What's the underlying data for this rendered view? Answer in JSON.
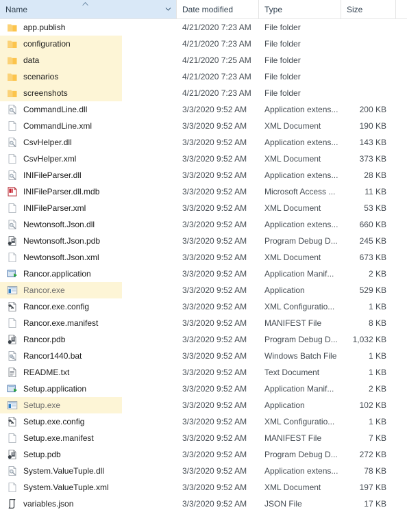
{
  "header": {
    "columns": [
      {
        "label": "Name",
        "sorted": true,
        "sort_direction": "ascending"
      },
      {
        "label": "Date modified",
        "sorted": false
      },
      {
        "label": "Type",
        "sorted": false
      },
      {
        "label": "Size",
        "sorted": false
      }
    ],
    "sort_caret_icon": "sort-ascending-caret-icon",
    "dropdown_icon": "chevron-down-icon"
  },
  "rows": [
    {
      "name": "app.publish",
      "date": "4/21/2020 7:23 AM",
      "type": "File folder",
      "size": "",
      "icon": "folder-icon",
      "highlighted": false,
      "dim": false
    },
    {
      "name": "configuration",
      "date": "4/21/2020 7:23 AM",
      "type": "File folder",
      "size": "",
      "icon": "folder-icon",
      "highlighted": true,
      "dim": false
    },
    {
      "name": "data",
      "date": "4/21/2020 7:25 AM",
      "type": "File folder",
      "size": "",
      "icon": "folder-icon",
      "highlighted": true,
      "dim": false
    },
    {
      "name": "scenarios",
      "date": "4/21/2020 7:23 AM",
      "type": "File folder",
      "size": "",
      "icon": "folder-icon",
      "highlighted": true,
      "dim": false
    },
    {
      "name": "screenshots",
      "date": "4/21/2020 7:23 AM",
      "type": "File folder",
      "size": "",
      "icon": "folder-icon",
      "highlighted": true,
      "dim": false
    },
    {
      "name": "CommandLine.dll",
      "date": "3/3/2020 9:52 AM",
      "type": "Application extens...",
      "size": "200 KB",
      "icon": "dll-icon",
      "highlighted": false,
      "dim": false
    },
    {
      "name": "CommandLine.xml",
      "date": "3/3/2020 9:52 AM",
      "type": "XML Document",
      "size": "190 KB",
      "icon": "blank-document-icon",
      "highlighted": false,
      "dim": false
    },
    {
      "name": "CsvHelper.dll",
      "date": "3/3/2020 9:52 AM",
      "type": "Application extens...",
      "size": "143 KB",
      "icon": "dll-icon",
      "highlighted": false,
      "dim": false
    },
    {
      "name": "CsvHelper.xml",
      "date": "3/3/2020 9:52 AM",
      "type": "XML Document",
      "size": "373 KB",
      "icon": "blank-document-icon",
      "highlighted": false,
      "dim": false
    },
    {
      "name": "INIFileParser.dll",
      "date": "3/3/2020 9:52 AM",
      "type": "Application extens...",
      "size": "28 KB",
      "icon": "dll-icon",
      "highlighted": false,
      "dim": false
    },
    {
      "name": "INIFileParser.dll.mdb",
      "date": "3/3/2020 9:52 AM",
      "type": "Microsoft Access ...",
      "size": "11 KB",
      "icon": "access-database-icon",
      "highlighted": false,
      "dim": false
    },
    {
      "name": "INIFileParser.xml",
      "date": "3/3/2020 9:52 AM",
      "type": "XML Document",
      "size": "53 KB",
      "icon": "blank-document-icon",
      "highlighted": false,
      "dim": false
    },
    {
      "name": "Newtonsoft.Json.dll",
      "date": "3/3/2020 9:52 AM",
      "type": "Application extens...",
      "size": "660 KB",
      "icon": "dll-icon",
      "highlighted": false,
      "dim": false
    },
    {
      "name": "Newtonsoft.Json.pdb",
      "date": "3/3/2020 9:52 AM",
      "type": "Program Debug D...",
      "size": "245 KB",
      "icon": "pdb-icon",
      "highlighted": false,
      "dim": false
    },
    {
      "name": "Newtonsoft.Json.xml",
      "date": "3/3/2020 9:52 AM",
      "type": "XML Document",
      "size": "673 KB",
      "icon": "blank-document-icon",
      "highlighted": false,
      "dim": false
    },
    {
      "name": "Rancor.application",
      "date": "3/3/2020 9:52 AM",
      "type": "Application Manif...",
      "size": "2 KB",
      "icon": "application-manifest-icon",
      "highlighted": false,
      "dim": false
    },
    {
      "name": "Rancor.exe",
      "date": "3/3/2020 9:52 AM",
      "type": "Application",
      "size": "529 KB",
      "icon": "application-exe-icon",
      "highlighted": true,
      "dim": true
    },
    {
      "name": "Rancor.exe.config",
      "date": "3/3/2020 9:52 AM",
      "type": "XML Configuratio...",
      "size": "1 KB",
      "icon": "xml-config-icon",
      "highlighted": false,
      "dim": false
    },
    {
      "name": "Rancor.exe.manifest",
      "date": "3/3/2020 9:52 AM",
      "type": "MANIFEST File",
      "size": "8 KB",
      "icon": "blank-document-icon",
      "highlighted": false,
      "dim": false
    },
    {
      "name": "Rancor.pdb",
      "date": "3/3/2020 9:52 AM",
      "type": "Program Debug D...",
      "size": "1,032 KB",
      "icon": "pdb-icon",
      "highlighted": false,
      "dim": false
    },
    {
      "name": "Rancor1440.bat",
      "date": "3/3/2020 9:52 AM",
      "type": "Windows Batch File",
      "size": "1 KB",
      "icon": "batch-file-icon",
      "highlighted": false,
      "dim": false
    },
    {
      "name": "README.txt",
      "date": "3/3/2020 9:52 AM",
      "type": "Text Document",
      "size": "1 KB",
      "icon": "text-document-icon",
      "highlighted": false,
      "dim": false
    },
    {
      "name": "Setup.application",
      "date": "3/3/2020 9:52 AM",
      "type": "Application Manif...",
      "size": "2 KB",
      "icon": "application-manifest-icon",
      "highlighted": false,
      "dim": false
    },
    {
      "name": "Setup.exe",
      "date": "3/3/2020 9:52 AM",
      "type": "Application",
      "size": "102 KB",
      "icon": "application-exe-icon",
      "highlighted": true,
      "dim": true
    },
    {
      "name": "Setup.exe.config",
      "date": "3/3/2020 9:52 AM",
      "type": "XML Configuratio...",
      "size": "1 KB",
      "icon": "xml-config-icon",
      "highlighted": false,
      "dim": false
    },
    {
      "name": "Setup.exe.manifest",
      "date": "3/3/2020 9:52 AM",
      "type": "MANIFEST File",
      "size": "7 KB",
      "icon": "blank-document-icon",
      "highlighted": false,
      "dim": false
    },
    {
      "name": "Setup.pdb",
      "date": "3/3/2020 9:52 AM",
      "type": "Program Debug D...",
      "size": "272 KB",
      "icon": "pdb-icon",
      "highlighted": false,
      "dim": false
    },
    {
      "name": "System.ValueTuple.dll",
      "date": "3/3/2020 9:52 AM",
      "type": "Application extens...",
      "size": "78 KB",
      "icon": "dll-icon",
      "highlighted": false,
      "dim": false
    },
    {
      "name": "System.ValueTuple.xml",
      "date": "3/3/2020 9:52 AM",
      "type": "XML Document",
      "size": "197 KB",
      "icon": "blank-document-icon",
      "highlighted": false,
      "dim": false
    },
    {
      "name": "variables.json",
      "date": "3/3/2020 9:52 AM",
      "type": "JSON File",
      "size": "17 KB",
      "icon": "json-file-icon",
      "highlighted": false,
      "dim": false
    }
  ],
  "colors": {
    "header_active_background": "#d9e8f7",
    "row_highlight": "#fdf5d6",
    "folder_icon": "#fcc44c",
    "text": "#1b1b1b",
    "secondary_text": "#444b52"
  }
}
